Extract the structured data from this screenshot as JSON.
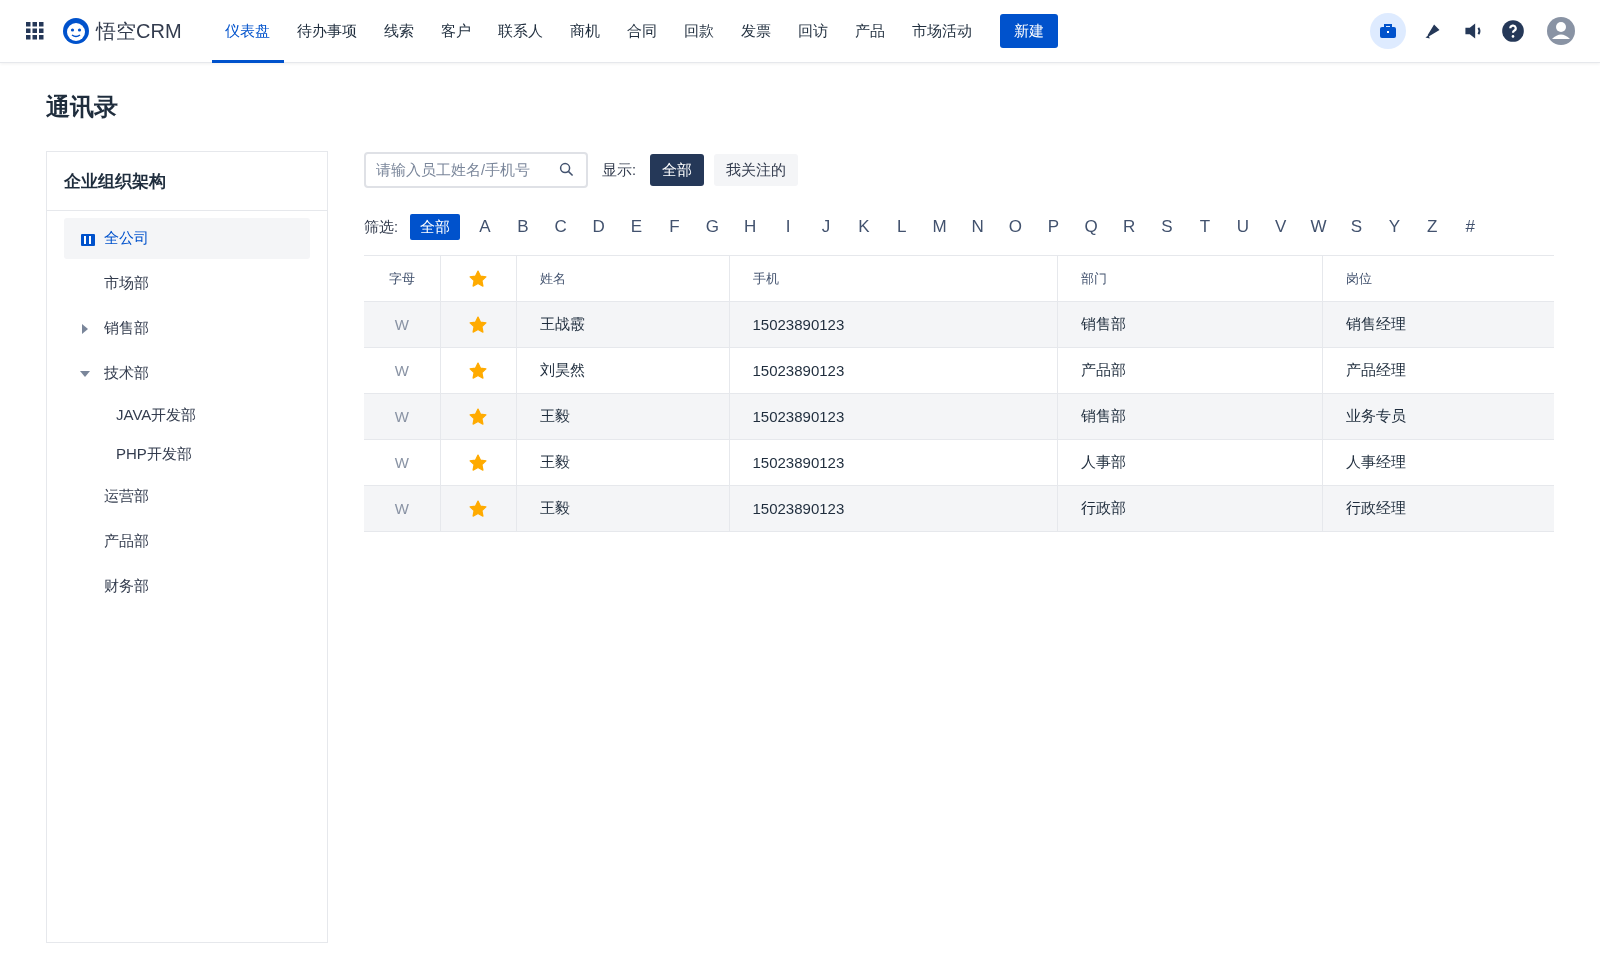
{
  "header": {
    "logo_text": "悟空CRM",
    "nav": [
      {
        "label": "仪表盘",
        "selected": true
      },
      {
        "label": "待办事项",
        "selected": false
      },
      {
        "label": "线索",
        "selected": false
      },
      {
        "label": "客户",
        "selected": false
      },
      {
        "label": "联系人",
        "selected": false
      },
      {
        "label": "商机",
        "selected": false
      },
      {
        "label": "合同",
        "selected": false
      },
      {
        "label": "回款",
        "selected": false
      },
      {
        "label": "发票",
        "selected": false
      },
      {
        "label": "回访",
        "selected": false
      },
      {
        "label": "产品",
        "selected": false
      },
      {
        "label": "市场活动",
        "selected": false
      }
    ],
    "new_button": "新建"
  },
  "page_title": "通讯录",
  "org_panel": {
    "title": "企业组织架构",
    "root": {
      "label": "全公司",
      "selected": true
    },
    "items": [
      {
        "label": "市场部",
        "selected": false
      },
      {
        "label": "销售部",
        "selected": false,
        "expanded": false
      },
      {
        "label": "技术部",
        "selected": false,
        "expanded": true,
        "children": [
          {
            "label": "JAVA开发部",
            "selected": false
          },
          {
            "label": "PHP开发部",
            "selected": false
          }
        ]
      },
      {
        "label": "运营部",
        "selected": false
      },
      {
        "label": "产品部",
        "selected": false
      },
      {
        "label": "财务部",
        "selected": false
      }
    ]
  },
  "search": {
    "placeholder": "请输入员工姓名/手机号"
  },
  "show": {
    "label": "显示:",
    "options": [
      {
        "label": "全部",
        "selected": true
      },
      {
        "label": "我关注的",
        "selected": false
      }
    ]
  },
  "filter": {
    "label": "筛选:",
    "options": [
      {
        "label": "全部",
        "selected": true
      },
      {
        "label": "A",
        "selected": false
      },
      {
        "label": "B",
        "selected": false
      },
      {
        "label": "C",
        "selected": false
      },
      {
        "label": "D",
        "selected": false
      },
      {
        "label": "E",
        "selected": false
      },
      {
        "label": "F",
        "selected": false
      },
      {
        "label": "G",
        "selected": false
      },
      {
        "label": "H",
        "selected": false
      },
      {
        "label": "I",
        "selected": false
      },
      {
        "label": "J",
        "selected": false
      },
      {
        "label": "K",
        "selected": false
      },
      {
        "label": "L",
        "selected": false
      },
      {
        "label": "M",
        "selected": false
      },
      {
        "label": "N",
        "selected": false
      },
      {
        "label": "O",
        "selected": false
      },
      {
        "label": "P",
        "selected": false
      },
      {
        "label": "Q",
        "selected": false
      },
      {
        "label": "R",
        "selected": false
      },
      {
        "label": "S",
        "selected": false
      },
      {
        "label": "T",
        "selected": false
      },
      {
        "label": "U",
        "selected": false
      },
      {
        "label": "V",
        "selected": false
      },
      {
        "label": "W",
        "selected": false
      },
      {
        "label": "S",
        "selected": false
      },
      {
        "label": "Y",
        "selected": false
      },
      {
        "label": "Z",
        "selected": false
      },
      {
        "label": "#",
        "selected": false
      }
    ]
  },
  "table": {
    "columns": [
      "字母",
      "姓名",
      "手机",
      "部门",
      "岗位"
    ],
    "rows": [
      {
        "letter": "W",
        "starred": true,
        "name": "王战霰",
        "phone": "15023890123",
        "department": "销售部",
        "position": "销售经理"
      },
      {
        "letter": "W",
        "starred": true,
        "name": "刘昊然",
        "phone": "15023890123",
        "department": "产品部",
        "position": "产品经理"
      },
      {
        "letter": "W",
        "starred": true,
        "name": "王毅",
        "phone": "15023890123",
        "department": "销售部",
        "position": "业务专员"
      },
      {
        "letter": "W",
        "starred": true,
        "name": "王毅",
        "phone": "15023890123",
        "department": "人事部",
        "position": "人事经理"
      },
      {
        "letter": "W",
        "starred": true,
        "name": "王毅",
        "phone": "15023890123",
        "department": "行政部",
        "position": "行政经理"
      }
    ]
  }
}
